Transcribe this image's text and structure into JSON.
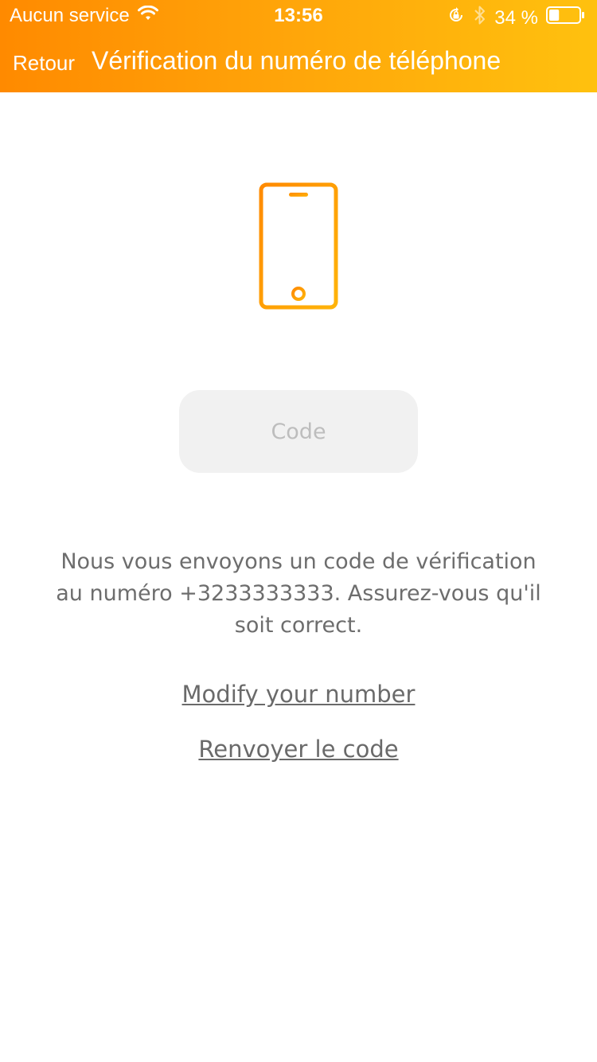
{
  "status_bar": {
    "carrier": "Aucun service",
    "time": "13:56",
    "battery_percent_label": "34 %",
    "battery_level": 0.34,
    "icons": [
      "wifi-icon",
      "rotation-lock-icon",
      "bluetooth-icon",
      "battery-icon"
    ]
  },
  "nav": {
    "back_label": "Retour",
    "title": "Vérification du numéro de téléphone"
  },
  "code_field": {
    "placeholder": "Code",
    "value": ""
  },
  "info": {
    "message": "Nous vous envoyons un code de vérification au numéro +3233333333. Assurez-vous qu'il soit correct."
  },
  "links": {
    "modify_number": "Modify your number",
    "resend_code": "Renvoyer le code"
  },
  "colors": {
    "header_gradient_start": "#ff8a00",
    "header_gradient_end": "#ffc10e",
    "accent": "#ffa000",
    "text_muted": "#6d6d6d",
    "input_bg": "#f1f1f1"
  },
  "illustration": {
    "icon": "smartphone-icon"
  }
}
